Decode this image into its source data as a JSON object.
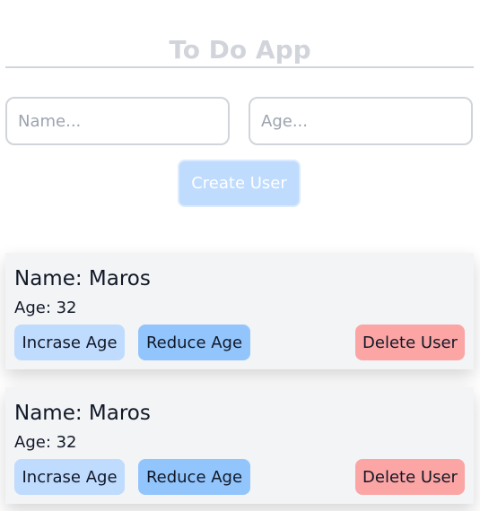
{
  "header": {
    "title": "To Do App"
  },
  "form": {
    "name_placeholder": "Name...",
    "age_placeholder": "Age...",
    "name_value": "",
    "age_value": "",
    "create_label": "Create User"
  },
  "users": [
    {
      "name_text": "Name: Maros",
      "age_text": "Age: 32",
      "increase_label": "Incrase Age",
      "reduce_label": "Reduce Age",
      "delete_label": "Delete User"
    },
    {
      "name_text": "Name: Maros",
      "age_text": "Age: 32",
      "increase_label": "Incrase Age",
      "reduce_label": "Reduce Age",
      "delete_label": "Delete User"
    }
  ],
  "colors": {
    "title": "#d1d5db",
    "create_button": "#bfdbfe",
    "increase_button": "#bfdbfe",
    "reduce_button": "#93c5fd",
    "delete_button": "#fca5a5",
    "card_background": "#f3f4f6"
  }
}
